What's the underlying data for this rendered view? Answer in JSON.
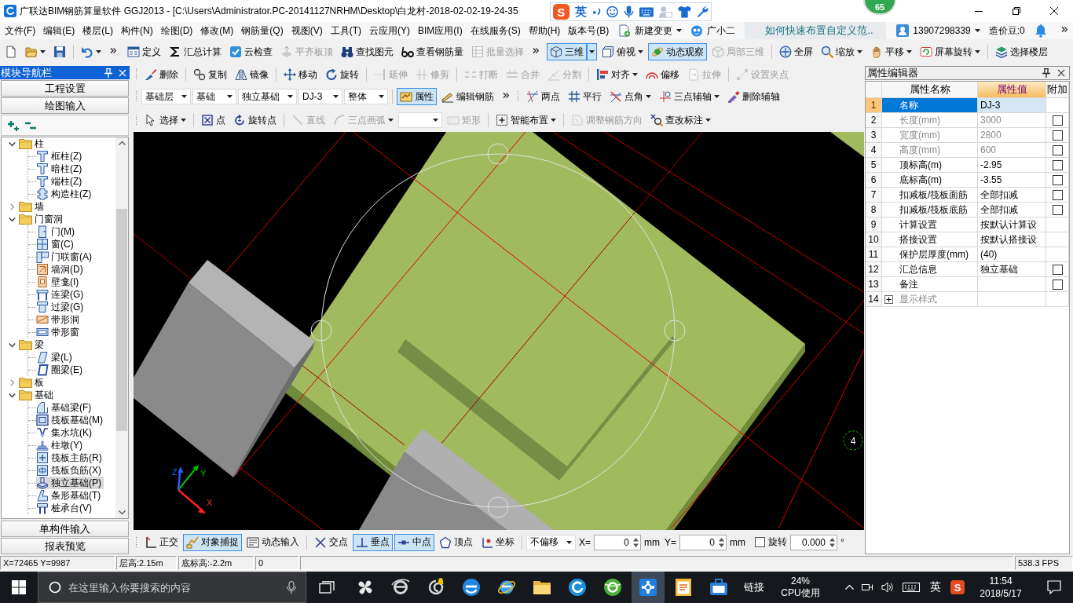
{
  "window": {
    "title": "广联达BIM钢筋算量软件 GGJ2013 - [C:\\Users\\Administrator.PC-20141127NRHM\\Desktop\\白龙村-2018-02-02-19-24-35",
    "badge": "65"
  },
  "ime_bar": {
    "logo": "S",
    "mode": "英"
  },
  "menu_bar": {
    "items": [
      "文件(F)",
      "编辑(E)",
      "楼层(L)",
      "构件(N)",
      "绘图(D)",
      "修改(M)",
      "钢筋量(Q)",
      "视图(V)",
      "工具(T)",
      "云应用(Y)",
      "BIM应用(I)",
      "在线服务(S)",
      "帮助(H)",
      "版本号(B)"
    ],
    "actions": [
      {
        "label": "新建变更",
        "dropdown": true
      },
      {
        "label": "广小二",
        "dropdown": false
      }
    ],
    "tip": "如何快速布置自定义范..",
    "account": {
      "label": "13907298339",
      "dropdown": true
    },
    "beans": "造价豆:0"
  },
  "main_toolbar": {
    "segments": [
      {
        "overflow": true,
        "groups": [
          [
            {
              "kind": "button",
              "disabled": false,
              "pressed": false,
              "dropdown": false
            },
            {
              "kind": "button",
              "disabled": false,
              "pressed": false,
              "dropdown": true
            },
            {
              "kind": "button",
              "disabled": false,
              "pressed": false,
              "dropdown": false
            }
          ],
          [
            {
              "kind": "button",
              "disabled": false,
              "pressed": false,
              "dropdown": true
            }
          ]
        ]
      },
      {
        "overflow": true,
        "groups": [
          [
            {
              "kind": "button",
              "label": "定义",
              "disabled": false,
              "pressed": false,
              "dropdown": false
            },
            {
              "kind": "button",
              "label": "汇总计算",
              "disabled": false,
              "pressed": false,
              "dropdown": false
            },
            {
              "kind": "button",
              "label": "云检查",
              "disabled": false,
              "pressed": false,
              "dropdown": false
            },
            {
              "kind": "button",
              "label": "平齐板顶",
              "disabled": true,
              "pressed": false,
              "dropdown": false
            },
            {
              "kind": "button",
              "label": "查找图元",
              "disabled": false,
              "pressed": false,
              "dropdown": false
            },
            {
              "kind": "button",
              "label": "查看钢筋量",
              "disabled": false,
              "pressed": false,
              "dropdown": false
            },
            {
              "kind": "button",
              "label": "批量选择",
              "disabled": true,
              "pressed": false,
              "dropdown": false
            }
          ]
        ]
      },
      {
        "overflow": false,
        "groups": [
          [
            {
              "kind": "split",
              "label": "三维",
              "disabled": false,
              "pressed": true,
              "dropdown": true
            },
            {
              "kind": "button",
              "label": "俯视",
              "disabled": false,
              "pressed": false,
              "dropdown": true
            },
            {
              "kind": "button",
              "label": "动态观察",
              "disabled": false,
              "pressed": true,
              "dropdown": false
            },
            {
              "kind": "button",
              "label": "局部三维",
              "disabled": true,
              "pressed": false,
              "dropdown": false
            }
          ],
          [
            {
              "kind": "button",
              "label": "全屏",
              "disabled": false,
              "pressed": false,
              "dropdown": false
            },
            {
              "kind": "button",
              "label": "缩放",
              "disabled": false,
              "pressed": false,
              "dropdown": true
            },
            {
              "kind": "button",
              "label": "平移",
              "disabled": false,
              "pressed": false,
              "dropdown": true
            },
            {
              "kind": "button",
              "label": "屏幕旋转",
              "disabled": false,
              "pressed": false,
              "dropdown": true
            }
          ],
          [
            {
              "kind": "button",
              "label": "选择楼层",
              "disabled": false,
              "pressed": false,
              "dropdown": false
            }
          ]
        ]
      }
    ]
  },
  "edit_toolbar": {
    "segments": [
      {
        "overflow": false,
        "groups": [
          [
            {
              "kind": "button",
              "label": "删除",
              "disabled": false,
              "pressed": false,
              "dropdown": false
            }
          ],
          [
            {
              "kind": "button",
              "label": "复制",
              "disabled": false,
              "pressed": false,
              "dropdown": false
            },
            {
              "kind": "button",
              "label": "镜像",
              "disabled": false,
              "pressed": false,
              "dropdown": false
            }
          ],
          [
            {
              "kind": "button",
              "label": "移动",
              "disabled": false,
              "pressed": false,
              "dropdown": false
            },
            {
              "kind": "button",
              "label": "旋转",
              "disabled": false,
              "pressed": false,
              "dropdown": false
            }
          ],
          [
            {
              "kind": "button",
              "label": "延伸",
              "disabled": true,
              "pressed": false,
              "dropdown": false
            },
            {
              "kind": "button",
              "label": "修剪",
              "disabled": true,
              "pressed": false,
              "dropdown": false
            }
          ],
          [
            {
              "kind": "button",
              "label": "打断",
              "disabled": true,
              "pressed": false,
              "dropdown": false
            },
            {
              "kind": "button",
              "label": "合并",
              "disabled": true,
              "pressed": false,
              "dropdown": false
            },
            {
              "kind": "button",
              "label": "分割",
              "disabled": true,
              "pressed": false,
              "dropdown": false
            }
          ],
          [
            {
              "kind": "button",
              "label": "对齐",
              "disabled": false,
              "pressed": false,
              "dropdown": true
            },
            {
              "kind": "button",
              "label": "偏移",
              "disabled": false,
              "pressed": false,
              "dropdown": false
            },
            {
              "kind": "button",
              "label": "拉伸",
              "disabled": true,
              "pressed": false,
              "dropdown": false
            }
          ],
          [
            {
              "kind": "button",
              "label": "设置夹点",
              "disabled": true,
              "pressed": false,
              "dropdown": false
            }
          ]
        ]
      }
    ]
  },
  "layer_toolbar": {
    "segments": [
      {
        "overflow": true,
        "groups": [
          [
            {
              "kind": "select",
              "value": "基础层",
              "disabled": false
            },
            {
              "kind": "select",
              "value": "基础",
              "disabled": false
            },
            {
              "kind": "select",
              "value": "独立基础",
              "disabled": false
            },
            {
              "kind": "select",
              "value": "DJ-3",
              "disabled": false
            },
            {
              "kind": "select",
              "value": "整体",
              "disabled": false
            }
          ],
          [
            {
              "kind": "button",
              "label": "属性",
              "disabled": false,
              "pressed": true,
              "dropdown": false
            },
            {
              "kind": "button",
              "label": "编辑钢筋",
              "disabled": false,
              "pressed": false,
              "dropdown": false
            }
          ]
        ]
      },
      {
        "overflow": false,
        "groups": [
          [
            {
              "kind": "button",
              "label": "两点",
              "disabled": false,
              "pressed": false,
              "dropdown": false
            },
            {
              "kind": "button",
              "label": "平行",
              "disabled": false,
              "pressed": false,
              "dropdown": false
            },
            {
              "kind": "button",
              "label": "点角",
              "disabled": false,
              "pressed": false,
              "dropdown": true
            },
            {
              "kind": "button",
              "label": "三点辅轴",
              "disabled": false,
              "pressed": false,
              "dropdown": true
            },
            {
              "kind": "button",
              "label": "删除辅轴",
              "disabled": false,
              "pressed": false,
              "dropdown": false
            }
          ]
        ]
      }
    ]
  },
  "draw_toolbar": {
    "segments": [
      {
        "overflow": false,
        "groups": [
          [
            {
              "kind": "button",
              "label": "选择",
              "disabled": false,
              "pressed": false,
              "dropdown": true
            }
          ],
          [
            {
              "kind": "button",
              "label": "点",
              "disabled": false,
              "pressed": false,
              "dropdown": false
            },
            {
              "kind": "button",
              "label": "旋转点",
              "disabled": false,
              "pressed": false,
              "dropdown": false
            }
          ],
          [
            {
              "kind": "button",
              "label": "直线",
              "disabled": true,
              "pressed": false,
              "dropdown": false
            },
            {
              "kind": "button",
              "label": "三点画弧",
              "disabled": true,
              "pressed": false,
              "dropdown": true
            },
            {
              "kind": "select",
              "disabled": false
            },
            {
              "kind": "button",
              "label": "矩形",
              "disabled": true,
              "pressed": false,
              "dropdown": false
            }
          ],
          [
            {
              "kind": "button",
              "label": "智能布置",
              "disabled": false,
              "pressed": false,
              "dropdown": true
            }
          ],
          [
            {
              "kind": "button",
              "label": "调整钢筋方向",
              "disabled": true,
              "pressed": false,
              "dropdown": false
            },
            {
              "kind": "button",
              "label": "查改标注",
              "disabled": false,
              "pressed": false,
              "dropdown": true
            }
          ]
        ]
      }
    ]
  },
  "nav_panel": {
    "title": "模块导航栏",
    "top_buttons": [
      "工程设置",
      "绘图输入"
    ],
    "tree": [
      {
        "kind": "folder",
        "label": "柱",
        "expanded": true,
        "selected": false,
        "children": [
          {
            "kind": "item",
            "label": "框柱(Z)",
            "selected": false
          },
          {
            "kind": "item",
            "label": "暗柱(Z)",
            "selected": false
          },
          {
            "kind": "item",
            "label": "端柱(Z)",
            "selected": false
          },
          {
            "kind": "item",
            "label": "构造柱(Z)",
            "selected": false
          }
        ]
      },
      {
        "kind": "folder",
        "label": "墙",
        "expanded": false,
        "selected": false
      },
      {
        "kind": "folder",
        "label": "门窗洞",
        "expanded": true,
        "selected": false,
        "children": [
          {
            "kind": "item",
            "label": "门(M)",
            "selected": false
          },
          {
            "kind": "item",
            "label": "窗(C)",
            "selected": false
          },
          {
            "kind": "item",
            "label": "门联窗(A)",
            "selected": false
          },
          {
            "kind": "item",
            "label": "墙洞(D)",
            "selected": false
          },
          {
            "kind": "item",
            "label": "壁龛(I)",
            "selected": false
          },
          {
            "kind": "item",
            "label": "连梁(G)",
            "selected": false
          },
          {
            "kind": "item",
            "label": "过梁(G)",
            "selected": false
          },
          {
            "kind": "item",
            "label": "带形洞",
            "selected": false
          },
          {
            "kind": "item",
            "label": "带形窗",
            "selected": false
          }
        ]
      },
      {
        "kind": "folder",
        "label": "梁",
        "expanded": true,
        "selected": false,
        "children": [
          {
            "kind": "item",
            "label": "梁(L)",
            "selected": false
          },
          {
            "kind": "item",
            "label": "圈梁(E)",
            "selected": false
          }
        ]
      },
      {
        "kind": "folder",
        "label": "板",
        "expanded": false,
        "selected": false
      },
      {
        "kind": "folder",
        "label": "基础",
        "expanded": true,
        "selected": false,
        "children": [
          {
            "kind": "item",
            "label": "基础梁(F)",
            "selected": false
          },
          {
            "kind": "item",
            "label": "筏板基础(M)",
            "selected": false
          },
          {
            "kind": "item",
            "label": "集水坑(K)",
            "selected": false
          },
          {
            "kind": "item",
            "label": "柱墩(Y)",
            "selected": false
          },
          {
            "kind": "item",
            "label": "筏板主筋(R)",
            "selected": false
          },
          {
            "kind": "item",
            "label": "筏板负筋(X)",
            "selected": false
          },
          {
            "kind": "item",
            "label": "独立基础(P)",
            "selected": true
          },
          {
            "kind": "item",
            "label": "条形基础(T)",
            "selected": false
          },
          {
            "kind": "item",
            "label": "桩承台(V)",
            "selected": false
          }
        ]
      }
    ],
    "bottom_buttons": [
      "单构件输入",
      "报表预览"
    ]
  },
  "viewport": {
    "gizmo_labels": [
      "Z",
      "Y",
      "X"
    ],
    "axis_marker": "4"
  },
  "bottom_toolbar": {
    "segments": [
      {
        "overflow": false,
        "groups": [
          [
            {
              "kind": "button",
              "label": "正交",
              "disabled": false,
              "pressed": false,
              "dropdown": false
            },
            {
              "kind": "button",
              "label": "对象捕捉",
              "disabled": false,
              "pressed": true,
              "dropdown": false
            },
            {
              "kind": "button",
              "label": "动态输入",
              "disabled": false,
              "pressed": false,
              "dropdown": false
            }
          ],
          [
            {
              "kind": "button",
              "label": "交点",
              "disabled": false,
              "pressed": false,
              "dropdown": false
            },
            {
              "kind": "button",
              "label": "垂点",
              "disabled": false,
              "pressed": true,
              "dropdown": false
            },
            {
              "kind": "button",
              "label": "中点",
              "disabled": false,
              "pressed": true,
              "dropdown": false
            },
            {
              "kind": "button",
              "label": "顶点",
              "disabled": false,
              "pressed": false,
              "dropdown": false
            },
            {
              "kind": "button",
              "label": "坐标",
              "disabled": false,
              "pressed": false,
              "dropdown": false
            }
          ],
          [
            {
              "kind": "select",
              "value": "不偏移",
              "disabled": false
            },
            {
              "kind": "label",
              "text": "X="
            },
            {
              "kind": "field",
              "value": "0"
            },
            {
              "kind": "label",
              "text": "mm"
            },
            {
              "kind": "label",
              "text": "Y="
            },
            {
              "kind": "field",
              "value": "0"
            },
            {
              "kind": "label",
              "text": "mm"
            },
            {
              "kind": "check",
              "label": "旋转",
              "checked": false
            },
            {
              "kind": "field",
              "value": "0.000"
            },
            {
              "kind": "label",
              "text": "°"
            }
          ]
        ]
      }
    ]
  },
  "property_panel": {
    "title": "属性编辑器",
    "columns": [
      "属性名称",
      "属性值",
      "附加"
    ],
    "rows": [
      {
        "num": "1",
        "name": "名称",
        "value": "DJ-3",
        "kind": "plain",
        "selected": true,
        "disabled": false
      },
      {
        "num": "2",
        "name": "长度(mm)",
        "value": "3000",
        "kind": "check",
        "checked": false,
        "selected": false,
        "disabled": true
      },
      {
        "num": "3",
        "name": "宽度(mm)",
        "value": "2800",
        "kind": "check",
        "checked": false,
        "selected": false,
        "disabled": true
      },
      {
        "num": "4",
        "name": "高度(mm)",
        "value": "600",
        "kind": "check",
        "checked": false,
        "selected": false,
        "disabled": true
      },
      {
        "num": "5",
        "name": "顶标高(m)",
        "value": "-2.95",
        "kind": "check",
        "checked": false,
        "selected": false,
        "disabled": false
      },
      {
        "num": "6",
        "name": "底标高(m)",
        "value": "-3.55",
        "kind": "check",
        "checked": false,
        "selected": false,
        "disabled": false
      },
      {
        "num": "7",
        "name": "扣减板/筏板面筋",
        "value": "全部扣减",
        "kind": "check",
        "checked": false,
        "selected": false,
        "disabled": false
      },
      {
        "num": "8",
        "name": "扣减板/筏板底筋",
        "value": "全部扣减",
        "kind": "check",
        "checked": false,
        "selected": false,
        "disabled": false
      },
      {
        "num": "9",
        "name": "计算设置",
        "value": "按默认计算设",
        "kind": "plain",
        "selected": false,
        "disabled": false
      },
      {
        "num": "10",
        "name": "搭接设置",
        "value": "按默认搭接设",
        "kind": "plain",
        "selected": false,
        "disabled": false
      },
      {
        "num": "11",
        "name": "保护层厚度(mm)",
        "value": "(40)",
        "kind": "plain",
        "selected": false,
        "disabled": false
      },
      {
        "num": "12",
        "name": "汇总信息",
        "value": "独立基础",
        "kind": "check",
        "checked": false,
        "selected": false,
        "disabled": false
      },
      {
        "num": "13",
        "name": "备注",
        "kind": "check",
        "checked": false,
        "selected": false,
        "disabled": false
      },
      {
        "num": "14",
        "name": "显示样式",
        "kind": "group",
        "expanded": false,
        "selected": false,
        "disabled": true
      }
    ]
  },
  "status_bar": {
    "cells": [
      "X=72465 Y=9987",
      "层高:2.15m",
      "底标高:-2.2m",
      "0"
    ],
    "fps": "538.3 FPS"
  },
  "taskbar": {
    "search": {
      "placeholder": "在这里输入你要搜索的内容"
    },
    "apps": [
      {
        "selected": false
      },
      {
        "selected": false
      },
      {
        "selected": false
      },
      {
        "selected": false
      },
      {
        "selected": false
      },
      {
        "selected": false
      },
      {
        "selected": false
      },
      {
        "selected": false
      },
      {
        "selected": true
      },
      {
        "selected": false
      },
      {
        "selected": false
      }
    ],
    "links": "链接",
    "cpu": {
      "value": "24%",
      "label": "CPU使用"
    },
    "language": "英",
    "ime_logo": "S",
    "clock": {
      "time": "11:54",
      "date": "2018/5/17"
    }
  }
}
